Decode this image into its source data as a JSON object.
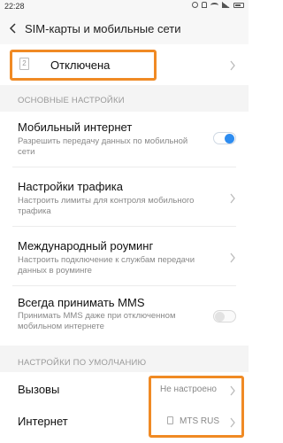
{
  "status_bar": {
    "time": "22:28"
  },
  "header": {
    "title": "SIM-карты и мобильные сети"
  },
  "sim": {
    "slot_number": "2",
    "label": "Отключена"
  },
  "sections": {
    "main": "ОСНОВНЫЕ НАСТРОЙКИ",
    "defaults": "НАСТРОЙКИ ПО УМОЛЧАНИЮ"
  },
  "rows": {
    "mobile_internet": {
      "title": "Мобильный интернет",
      "subtitle": "Разрешить передачу данных по мобильной сети",
      "enabled": true
    },
    "traffic": {
      "title": "Настройки трафика",
      "subtitle": "Настроить лимиты для контроля мобильного трафика"
    },
    "roaming": {
      "title": "Международный роуминг",
      "subtitle": "Настроить подключение к службам передачи данных в роуминге"
    },
    "mms": {
      "title": "Всегда принимать MMS",
      "subtitle": "Принимать MMS даже при отключенном мобильном интернете",
      "enabled": false
    },
    "calls": {
      "title": "Вызовы",
      "value": "Не настроено"
    },
    "internet": {
      "title": "Интернет",
      "value": "MTS RUS"
    }
  },
  "colors": {
    "accent": "#2d8cf0",
    "highlight": "#f08a24"
  },
  "icons": {
    "back": "back-arrow-icon",
    "chevron": "chevron-right-icon",
    "sim": "sim-card-icon",
    "alarm": "alarm-icon",
    "mute": "mute-icon",
    "wifi": "wifi-icon",
    "signal": "signal-icon",
    "battery": "battery-icon"
  }
}
